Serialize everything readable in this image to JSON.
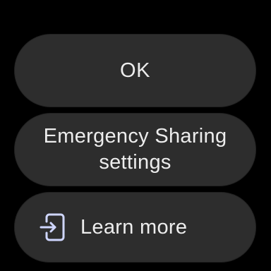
{
  "dialog": {
    "ok_label": "OK",
    "settings_label": "Emergency Sharing settings",
    "learn_more_label": "Learn more",
    "learn_more_icon": "open-on-phone-icon"
  },
  "colors": {
    "background": "#000000",
    "chip": "#2d2d2d",
    "text": "#ededed",
    "icon": "#cfd6ff"
  }
}
